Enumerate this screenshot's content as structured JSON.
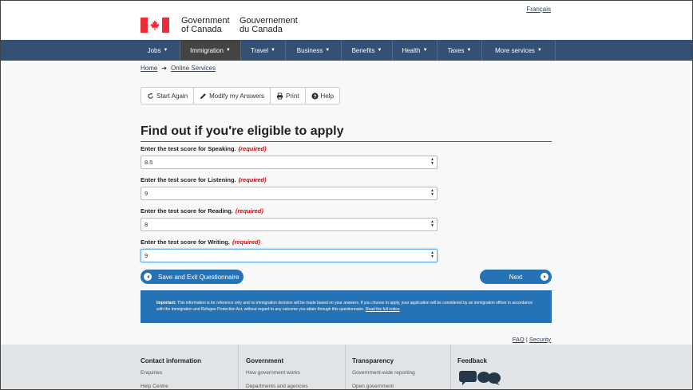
{
  "header": {
    "language_link": "Français",
    "gov_en": [
      "Government",
      "of Canada"
    ],
    "gov_fr": [
      "Gouvernement",
      "du Canada"
    ]
  },
  "nav": {
    "items": [
      {
        "label": "Jobs",
        "active": false
      },
      {
        "label": "Immigration",
        "active": true
      },
      {
        "label": "Travel",
        "active": false
      },
      {
        "label": "Business",
        "active": false
      },
      {
        "label": "Benefits",
        "active": false
      },
      {
        "label": "Health",
        "active": false
      },
      {
        "label": "Taxes",
        "active": false
      },
      {
        "label": "More services",
        "active": false
      }
    ]
  },
  "breadcrumb": {
    "home": "Home",
    "arrow": "➜",
    "current": "Online Services"
  },
  "toolbar": {
    "start_again": "Start Again",
    "modify": "Modify my Answers",
    "print": "Print",
    "help": "Help"
  },
  "form": {
    "title": "Find out if you're eligible to apply",
    "required_label": "(required)",
    "questions": [
      {
        "label": "Enter the test score for Speaking.",
        "value": "8.5"
      },
      {
        "label": "Enter the test score for Listening.",
        "value": "9"
      },
      {
        "label": "Enter the test score for Reading.",
        "value": "8"
      },
      {
        "label": "Enter the test score for Writing.",
        "value": "9"
      }
    ],
    "save_button": "Save and Exit Questionnaire",
    "next_button": "Next"
  },
  "notice": {
    "bold": "Important:",
    "text": "This information is for reference only and no immigration decision will be made based on your answers. If you choose to apply, your application will be considered by an immigration officer in accordance with the Immigration and Refugee Protection Act, without regard to any outcome you attain through this questionnaire.",
    "link": "Read the full notice"
  },
  "faq": {
    "faq": "FAQ",
    "sep": "|",
    "security": "Security"
  },
  "footer": {
    "contact": {
      "title": "Contact information",
      "links": [
        "Enquiries",
        "Help Centre"
      ]
    },
    "government": {
      "title": "Government",
      "links": [
        "How government works",
        "Departments and agencies"
      ]
    },
    "transparency": {
      "title": "Transparency",
      "links": [
        "Government-wide reporting",
        "Open government"
      ]
    },
    "feedback": {
      "title": "Feedback"
    }
  },
  "colors": {
    "nav_bg": "#335075",
    "accent_blue": "#2572b4",
    "flag_red": "#eb2d37",
    "required_red": "#d3080c"
  }
}
